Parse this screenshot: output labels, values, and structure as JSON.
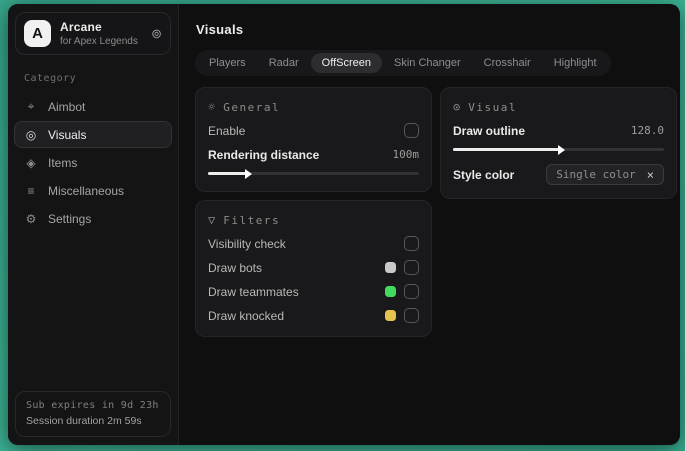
{
  "colors": {
    "accent_background": "#3cb495",
    "window_background": "#0f0f10",
    "panel_background": "#19191b",
    "swatch_bots": "#c9c9c9",
    "swatch_teammates": "#43d95e",
    "swatch_knocked": "#e4c44d"
  },
  "sidebar": {
    "logo_letter": "A",
    "app_name": "Arcane",
    "app_subtitle": "for Apex Legends",
    "header_icon_glyph": "⊚",
    "category_label": "Category",
    "items": [
      {
        "label": "Aimbot",
        "icon": "⌖"
      },
      {
        "label": "Visuals",
        "icon": "◎"
      },
      {
        "label": "Items",
        "icon": "◈"
      },
      {
        "label": "Miscellaneous",
        "icon": "≡"
      },
      {
        "label": "Settings",
        "icon": "⚙"
      }
    ],
    "footer": {
      "sub_expires": "Sub expires in 9d 23h",
      "session_duration": "Session duration 2m 59s"
    }
  },
  "header": {
    "title": "Visuals"
  },
  "tabs": [
    {
      "label": "Players"
    },
    {
      "label": "Radar"
    },
    {
      "label": "OffScreen"
    },
    {
      "label": "Skin Changer"
    },
    {
      "label": "Crosshair"
    },
    {
      "label": "Highlight"
    }
  ],
  "panels": {
    "general": {
      "icon": "☼",
      "title": "General",
      "enable_label": "Enable",
      "enable_checked": false,
      "rendering_label": "Rendering distance",
      "rendering_value": "100m",
      "rendering_fill_percent": 18
    },
    "filters": {
      "icon": "▽",
      "title": "Filters",
      "rows": [
        {
          "label": "Visibility check",
          "swatch": null,
          "checked": false
        },
        {
          "label": "Draw bots",
          "swatch": "#c9c9c9",
          "checked": false
        },
        {
          "label": "Draw teammates",
          "swatch": "#43d95e",
          "checked": false
        },
        {
          "label": "Draw knocked",
          "swatch": "#e4c44d",
          "checked": false
        }
      ]
    },
    "visual": {
      "icon": "⊙",
      "title": "Visual",
      "outline_label": "Draw outline",
      "outline_value": "128.0",
      "outline_fill_percent": 50,
      "style_label": "Style color",
      "style_value": "Single color",
      "style_clear_glyph": "×"
    }
  }
}
